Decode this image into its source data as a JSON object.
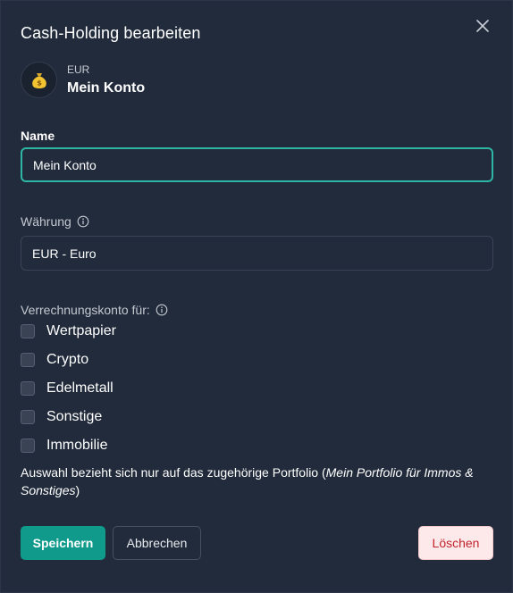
{
  "dialog": {
    "title": "Cash-Holding bearbeiten",
    "close_icon": "close-icon"
  },
  "header": {
    "avatar_icon": "money-bag-icon",
    "currency_code": "EUR",
    "account_name": "Mein Konto"
  },
  "form": {
    "name_label": "Name",
    "name_value": "Mein Konto",
    "currency_label": "Währung",
    "currency_value": "EUR - Euro",
    "clearing_label": "Verrechnungskonto für:",
    "options": [
      "Wertpapier",
      "Crypto",
      "Edelmetall",
      "Sonstige",
      "Immobilie"
    ],
    "hint_prefix": "Auswahl bezieht sich nur auf das zugehörige Portfolio (",
    "hint_italic": "Mein Portfolio für Immos & Sonstiges",
    "hint_suffix": ")"
  },
  "buttons": {
    "save": "Speichern",
    "cancel": "Abbrechen",
    "delete": "Löschen"
  },
  "colors": {
    "background": "#212b3b",
    "accent": "#0f9a8c",
    "focus_border": "#2fb5a4",
    "danger_text": "#c0232c",
    "danger_bg": "#fde9ea"
  }
}
